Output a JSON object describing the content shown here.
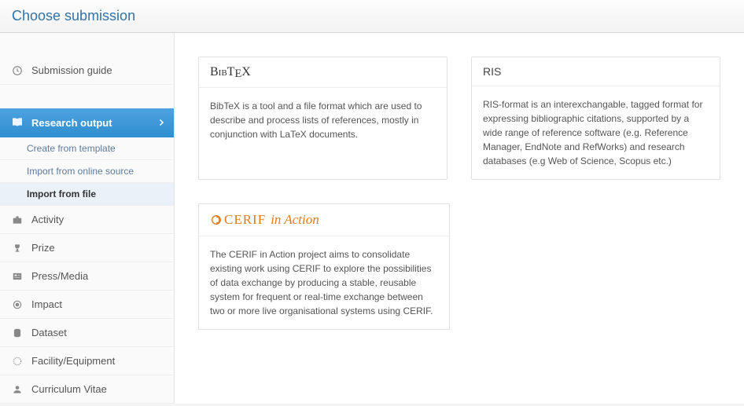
{
  "header": {
    "title": "Choose submission"
  },
  "sidebar": {
    "guide": "Submission guide",
    "research_output": "Research output",
    "sub": {
      "create_template": "Create from template",
      "import_online": "Import from online source",
      "import_file": "Import from file"
    },
    "activity": "Activity",
    "prize": "Prize",
    "press_media": "Press/Media",
    "impact": "Impact",
    "dataset": "Dataset",
    "facility_equipment": "Facility/Equipment",
    "cv": "Curriculum Vitae"
  },
  "cards": {
    "bibtex": {
      "title": "BibTeX",
      "body": "BibTeX is a tool and a file format which are used to describe and process lists of references, mostly in conjunction with LaTeX documents."
    },
    "ris": {
      "title": "RIS",
      "body": "RIS-format is an interexchangable, tagged format for expressing bibliographic citations, supported by a wide range of reference software (e.g. Reference Manager, EndNote and RefWorks) and research databases (e.g Web of Science, Scopus etc.)"
    },
    "cerif": {
      "title": "CERIF in Action",
      "body": "The CERIF in Action project aims to consolidate existing work using CERIF to explore the possibilities of data exchange by producing a stable, reusable system for frequent or real-time exchange between two or more live organisational systems using CERIF."
    }
  }
}
